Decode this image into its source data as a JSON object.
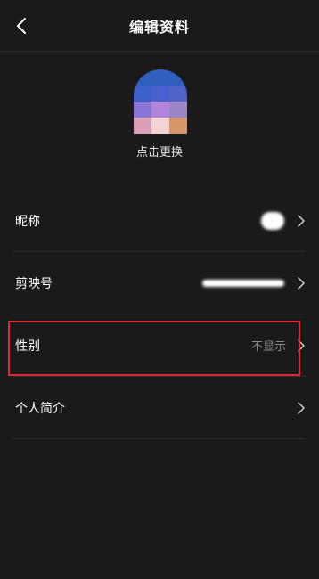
{
  "header": {
    "title": "编辑资料",
    "back_icon": "chevron-left-icon"
  },
  "avatar": {
    "change_label": "点击更换",
    "pixel_colors": [
      "#2f5fbe",
      "#2f5fbe",
      "#2f5fbe",
      "#3f62c8",
      "#4a5fd0",
      "#4d63c9",
      "#8877d6",
      "#b084d8",
      "#9a85c8",
      "#d9a0b8",
      "#f2d4d6",
      "#d7956a"
    ]
  },
  "rows": [
    {
      "label": "昵称",
      "value": "",
      "value_hidden": true,
      "chevron_icon": "chevron-right-icon"
    },
    {
      "label": "剪映号",
      "value": "",
      "value_hidden": true,
      "chevron_icon": "chevron-right-icon"
    },
    {
      "label": "性别",
      "value": "不显示",
      "value_hidden": false,
      "chevron_icon": "chevron-right-icon"
    },
    {
      "label": "个人简介",
      "value": "",
      "value_hidden": false,
      "chevron_icon": "chevron-right-icon"
    }
  ],
  "colors": {
    "background": "#1a1a1a",
    "highlight_border": "#e0282e",
    "secondary_text": "#8a8a8a"
  }
}
